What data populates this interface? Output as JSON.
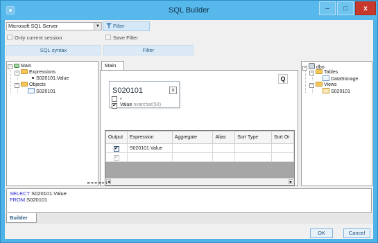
{
  "window": {
    "title": "SQL Builder",
    "minimize": "–",
    "maximize": "□",
    "close": "x"
  },
  "toolbar": {
    "server_value": "Microsoft SQL Server",
    "filter_label": "Filter",
    "only_current_session": "Only current session",
    "save_filter": "Save Filter",
    "tab_sql_syntax": "SQL syntax",
    "tab_filter": "Filter"
  },
  "query_tree": {
    "root": "Main",
    "expressions": "Expressions",
    "expression_item": "S020101.Value",
    "objects": "Objects",
    "object_item": "S020101"
  },
  "designer": {
    "tab": "Main",
    "table_name": "S020101",
    "close_glyph": "x",
    "star_row": "*",
    "field_name": "Value",
    "field_type": "nvarchar(50)",
    "query_button": "Q"
  },
  "grid": {
    "columns": [
      "Output",
      "Expression",
      "Aggregate",
      "Alias",
      "Sort Type",
      "Sort Or"
    ],
    "rows": [
      {
        "output": "✔",
        "expression": "S020101.Value"
      },
      {
        "output": "✔",
        "expression": ""
      }
    ]
  },
  "schema_tree": {
    "root": "dbo",
    "tables": "Tables",
    "table_item": "DataStorage",
    "views": "Views",
    "view_item": "S020101"
  },
  "sql": {
    "kw_select": "SELECT",
    "select_rest": " S020101.Value",
    "kw_from": "FROM",
    "from_rest": " S020101"
  },
  "bottom_tab": "Builder",
  "buttons": {
    "ok": "OK",
    "cancel": "Cancel"
  }
}
